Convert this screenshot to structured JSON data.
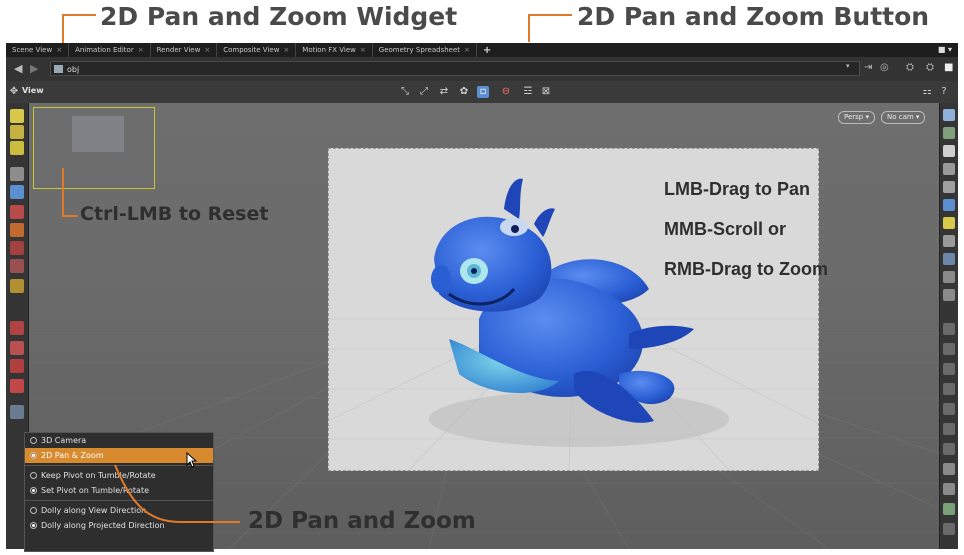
{
  "callouts": {
    "widget": "2D Pan and Zoom Widget",
    "button": "2D Pan and Zoom Button",
    "reset": "Ctrl-LMB to Reset",
    "mode": "2D Pan and Zoom"
  },
  "tabs": [
    {
      "label": "Scene View"
    },
    {
      "label": "Animation Editor"
    },
    {
      "label": "Render View"
    },
    {
      "label": "Composite View"
    },
    {
      "label": "Motion FX View"
    },
    {
      "label": "Geometry Spreadsheet"
    }
  ],
  "path": {
    "value": "obj"
  },
  "viewbar": {
    "label": "View"
  },
  "camera": {
    "persp": "Persp ▾",
    "nocam": "No cam ▾"
  },
  "instructions": {
    "line1": "LMB-Drag to Pan",
    "line2": "MMB-Scroll or",
    "line3": "RMB-Drag to Zoom"
  },
  "menu": {
    "items": [
      {
        "label": "3D Camera",
        "selected": false,
        "checked": false
      },
      {
        "label": "2D Pan & Zoom",
        "selected": true,
        "checked": true
      },
      {
        "label": "Keep Pivot on Tumble/Rotate",
        "selected": false,
        "checked": false
      },
      {
        "label": "Set Pivot on Tumble/Rotate",
        "selected": false,
        "checked": true
      },
      {
        "label": "Dolly along View Direction",
        "selected": false,
        "checked": false
      },
      {
        "label": "Dolly along Projected Direction",
        "selected": false,
        "checked": true
      }
    ]
  },
  "colors": {
    "accent": "#e07a28",
    "menu_highlight": "#d88a2e",
    "widget_border": "#c9c534",
    "dragon": "#2a5fd4"
  }
}
